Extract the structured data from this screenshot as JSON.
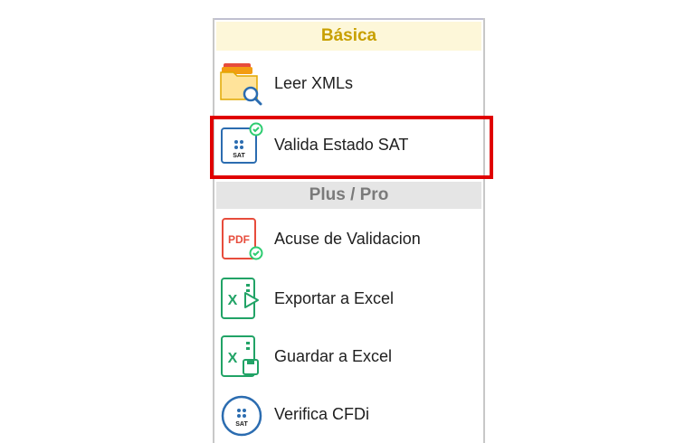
{
  "sections": {
    "basica": {
      "title": "Básica",
      "items": [
        {
          "label": "Leer XMLs",
          "icon": "folder-search-icon"
        },
        {
          "label": "Valida Estado SAT",
          "icon": "sat-document-check-icon"
        }
      ]
    },
    "plus_pro": {
      "title": "Plus / Pro",
      "items": [
        {
          "label": "Acuse de Validacion",
          "icon": "pdf-check-icon"
        },
        {
          "label": "Exportar a Excel",
          "icon": "excel-export-icon"
        },
        {
          "label": "Guardar a Excel",
          "icon": "excel-save-icon"
        },
        {
          "label": "Verifica CFDi",
          "icon": "sat-circle-icon"
        }
      ]
    }
  },
  "sat_badge_text": "SAT",
  "pdf_badge_text": "PDF",
  "excel_badge_text": "X",
  "colors": {
    "basica_header_bg": "#fdf7d9",
    "basica_header_text": "#c8a000",
    "plus_header_bg": "#e5e5e5",
    "plus_header_text": "#7a7a7a",
    "highlight": "#e00000",
    "excel_green": "#21a366",
    "pdf_red": "#e74c3c",
    "sat_blue": "#2b6cb0",
    "check_green": "#2ecc71"
  }
}
